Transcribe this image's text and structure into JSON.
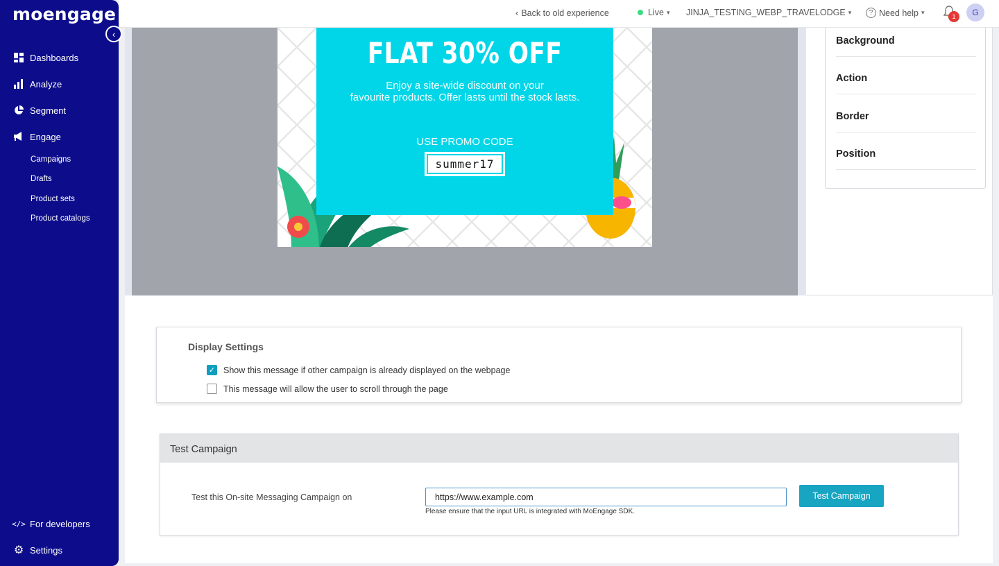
{
  "brand": {
    "logo": "moengage"
  },
  "sidebar": {
    "items": [
      {
        "label": "Dashboards",
        "icon": "dashboard-icon"
      },
      {
        "label": "Analyze",
        "icon": "bar-chart-icon"
      },
      {
        "label": "Segment",
        "icon": "pie-chart-icon"
      },
      {
        "label": "Engage",
        "icon": "megaphone-icon"
      }
    ],
    "engage_sub": [
      {
        "label": "Campaigns"
      },
      {
        "label": "Drafts"
      },
      {
        "label": "Product sets"
      },
      {
        "label": "Product catalogs"
      }
    ],
    "bottom": [
      {
        "label": "For developers",
        "icon": "code-icon"
      },
      {
        "label": "Settings",
        "icon": "gear-icon"
      }
    ]
  },
  "topbar": {
    "back_link": "Back to old experience",
    "env": "Live",
    "workspace": "JINJA_TESTING_WEBP_TRAVELODGE",
    "help": "Need help",
    "notifications_count": "1",
    "avatar_initial": "G"
  },
  "banner": {
    "title": "FLAT 30% OFF",
    "subtitle_line1": "Enjoy a site-wide discount on your",
    "subtitle_line2": "favourite products. Offer lasts until the stock lasts.",
    "code_label": "USE PROMO CODE",
    "code": "summer17"
  },
  "properties": {
    "items": [
      "Background",
      "Action",
      "Border",
      "Position"
    ]
  },
  "display_settings": {
    "title": "Display Settings",
    "options": [
      {
        "label": "Show this message if other campaign is already displayed on the webpage",
        "checked": true
      },
      {
        "label": "This message will allow the user to scroll through the page",
        "checked": false
      }
    ]
  },
  "test_campaign": {
    "header": "Test Campaign",
    "label": "Test this On-site Messaging Campaign on",
    "url_value": "https://www.example.com",
    "hint": "Please ensure that the input URL is integrated with MoEngage SDK.",
    "button": "Test Campaign"
  },
  "colors": {
    "sidebar": "#0d0d8c",
    "accent": "#18a5c2",
    "banner_cyan": "#00d6e8"
  }
}
